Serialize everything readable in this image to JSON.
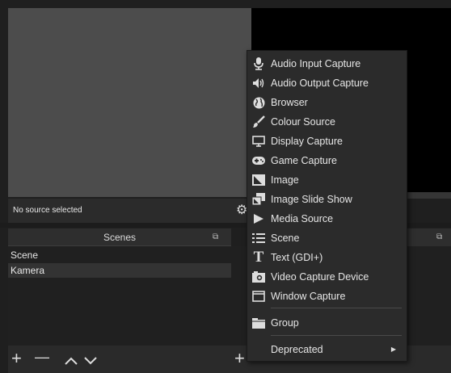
{
  "status": {
    "no_source": "No source selected"
  },
  "scenes": {
    "title": "Scenes",
    "items": [
      "Scene",
      "Kamera"
    ],
    "selected": "Kamera",
    "controls": {
      "add": "+",
      "remove": "—",
      "up": "^",
      "down": "v"
    }
  },
  "sources": {
    "add": "+"
  },
  "menu": {
    "items": [
      {
        "label": "Audio Input Capture",
        "icon": "microphone-icon"
      },
      {
        "label": "Audio Output Capture",
        "icon": "speaker-icon"
      },
      {
        "label": "Browser",
        "icon": "globe-icon"
      },
      {
        "label": "Colour Source",
        "icon": "paintbrush-icon"
      },
      {
        "label": "Display Capture",
        "icon": "monitor-icon"
      },
      {
        "label": "Game Capture",
        "icon": "gamepad-icon"
      },
      {
        "label": "Image",
        "icon": "image-icon"
      },
      {
        "label": "Image Slide Show",
        "icon": "slideshow-icon"
      },
      {
        "label": "Media Source",
        "icon": "play-icon"
      },
      {
        "label": "Scene",
        "icon": "list-icon"
      },
      {
        "label": "Text (GDI+)",
        "icon": "text-icon"
      },
      {
        "label": "Video Capture Device",
        "icon": "camera-icon"
      },
      {
        "label": "Window Capture",
        "icon": "window-icon"
      },
      {
        "label": "Group",
        "icon": "folder-icon"
      },
      {
        "label": "Deprecated",
        "icon": ""
      }
    ]
  }
}
